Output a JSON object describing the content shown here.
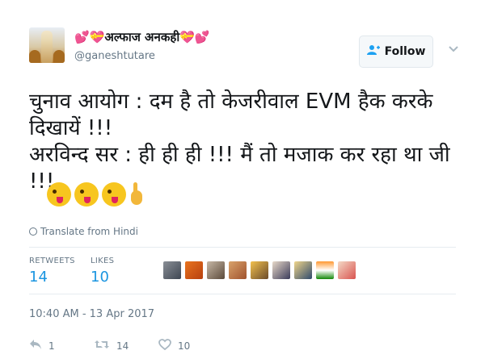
{
  "header": {
    "display_name": "💕💝अल्फाज अनकही💝💕",
    "handle": "@ganeshtutare",
    "follow_label": "Follow"
  },
  "tweet": {
    "text": "चुनाव आयोग : दम है तो केजरीवाल EVM हैक करके\nदिखायें !!!\nअरविन्द सर : ही ही ही !!! मैं तो मजाक कर रहा था जी\n!!!",
    "translate_label": "Translate from Hindi"
  },
  "stats": {
    "retweets_label": "RETWEETS",
    "retweets_count": "14",
    "likes_label": "LIKES",
    "likes_count": "10"
  },
  "timestamp": "10:40 AM - 13 Apr 2017",
  "actions": {
    "reply_count": "1",
    "retweet_count": "14",
    "like_count": "10"
  },
  "colors": {
    "accent": "#1da1f2",
    "link": "#1b95e0",
    "muted": "#657786"
  },
  "icons": [
    "follow-person-icon",
    "caret-down-icon",
    "globe-icon",
    "reply-icon",
    "retweet-icon",
    "like-icon"
  ]
}
